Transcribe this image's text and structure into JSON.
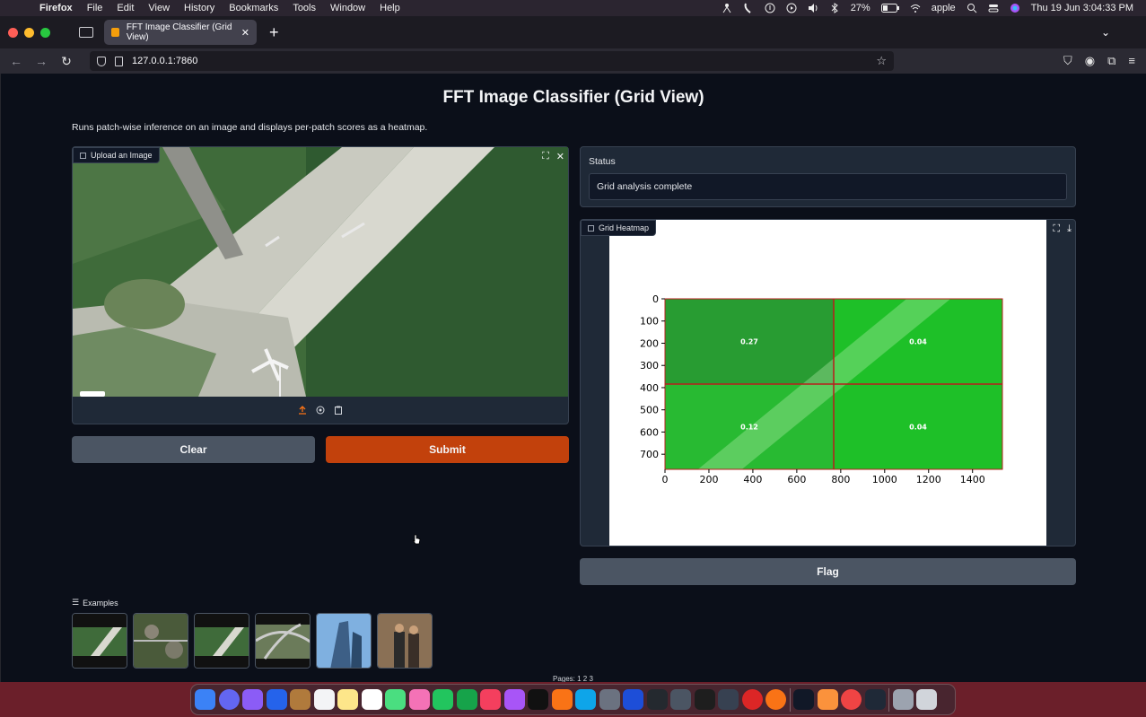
{
  "menubar": {
    "app": "Firefox",
    "items": [
      "File",
      "Edit",
      "View",
      "History",
      "Bookmarks",
      "Tools",
      "Window",
      "Help"
    ],
    "battery": "27%",
    "user": "apple",
    "clock": "Thu 19 Jun  3:04:33 PM"
  },
  "browser": {
    "tab_title": "FFT Image Classifier (Grid View)",
    "url": "127.0.0.1:7860"
  },
  "page": {
    "title": "FFT Image Classifier (Grid View)",
    "description": "Runs patch-wise inference on an image and displays per-patch scores as a heatmap.",
    "upload_label": "Upload an Image",
    "status_label": "Status",
    "status_value": "Grid analysis complete",
    "heatmap_label": "Grid Heatmap",
    "clear_label": "Clear",
    "submit_label": "Submit",
    "flag_label": "Flag",
    "examples_label": "Examples",
    "pages_text": "Pages: 1 2 3"
  },
  "chart_data": {
    "type": "heatmap",
    "x_ticks": [
      0,
      200,
      400,
      600,
      800,
      1000,
      1200,
      1400
    ],
    "y_ticks": [
      0,
      100,
      200,
      300,
      400,
      500,
      600,
      700
    ],
    "xlim": [
      0,
      1536
    ],
    "ylim": [
      768,
      0
    ],
    "grid": {
      "x_split": 768,
      "y_split": 384
    },
    "cells": [
      {
        "row": 0,
        "col": 0,
        "value": 0.27
      },
      {
        "row": 0,
        "col": 1,
        "value": 0.04
      },
      {
        "row": 1,
        "col": 0,
        "value": 0.12
      },
      {
        "row": 1,
        "col": 1,
        "value": 0.04
      }
    ],
    "cell_labels": [
      "0.27",
      "0.04",
      "0.12",
      "0.04"
    ]
  },
  "colors": {
    "submit": "#c2410c",
    "heat_green": "#22a32a",
    "grid_line": "#b91c1c"
  }
}
